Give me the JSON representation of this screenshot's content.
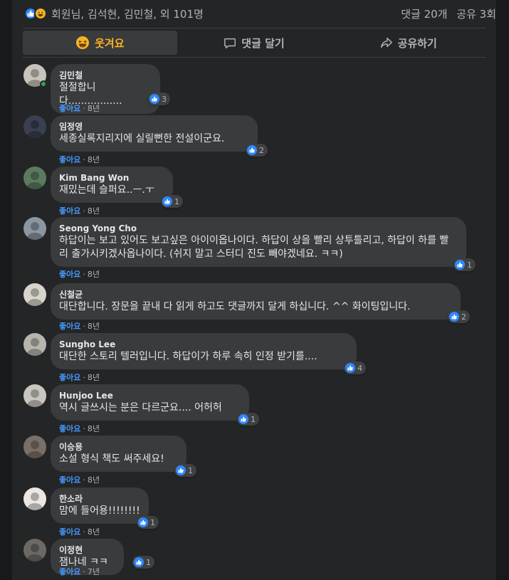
{
  "summary": {
    "reactors": "회원님, 김석현, 김민철, 외 101명",
    "comments": "댓글 20개",
    "shares": "공유 3회",
    "reaction_icons": [
      "like-icon",
      "haha-icon"
    ]
  },
  "actions": {
    "laugh": "웃겨요",
    "comment": "댓글 달기",
    "share": "공유하기"
  },
  "comments": [
    {
      "author": "김민철",
      "text": "절절합니다.................",
      "likes": "3",
      "like_label": "좋아요",
      "age": "8년",
      "online": true,
      "avatar_color": "#c8c4bc"
    },
    {
      "author": "임정영",
      "text": "세종실록지리지에 실릴뻔한 전설이군요.",
      "likes": "2",
      "like_label": "좋아요",
      "age": "8년",
      "avatar_color": "#3a3f52"
    },
    {
      "author": "Kim Bang Won",
      "text": "재밌는데 슬퍼요..ㅡ.ㅜ",
      "likes": "1",
      "like_label": "좋아요",
      "age": "8년",
      "avatar_color": "#5b7a5e"
    },
    {
      "author": "Seong Yong Cho",
      "text": "하답이는 보고 있어도 보고싶은 아이이옵나이다. 하답이 상을 빨리 상투틀리고, 하답이 하를 빨리 출가시키겠사옵나이다. (쉬지 말고 스터디 진도 빼야겠네요. ㅋㅋ)",
      "likes": "1",
      "like_label": "좋아요",
      "age": "8년",
      "avatar_color": "#8a96a0"
    },
    {
      "author": "신철균",
      "text": "대단합니다. 장문을 끝내 다 읽게 하고도 댓글까지 달게 하십니다. ^^ 화이팅입니다.",
      "likes": "2",
      "like_label": "좋아요",
      "age": "8년",
      "avatar_color": "#d9d4cc"
    },
    {
      "author": "Sungho Lee",
      "text": "대단한 스토리 텔러입니다. 하답이가 하루 속히 인정 받기를....",
      "likes": "4",
      "like_label": "좋아요",
      "age": "8년",
      "avatar_color": "#b8b4ae"
    },
    {
      "author": "Hunjoo Lee",
      "text": "역시 글쓰시는 분은 다르군요.... 어허허",
      "likes": "1",
      "like_label": "좋아요",
      "age": "8년",
      "avatar_color": "#c9c6bf"
    },
    {
      "author": "이승용",
      "text": "소설 형식 책도 써주세요!",
      "likes": "1",
      "like_label": "좋아요",
      "age": "8년",
      "avatar_color": "#7a6f66"
    },
    {
      "author": "한소라",
      "text": "맘에 들어용!!!!!!!!",
      "likes": "1",
      "like_label": "좋아요",
      "age": "8년",
      "avatar_color": "#ece7e2"
    },
    {
      "author": "이정현",
      "text": "잼나네 ㅋㅋ",
      "likes": "1",
      "like_label": "좋아요",
      "age": "7년",
      "avatar_color": "#6c6864"
    }
  ]
}
